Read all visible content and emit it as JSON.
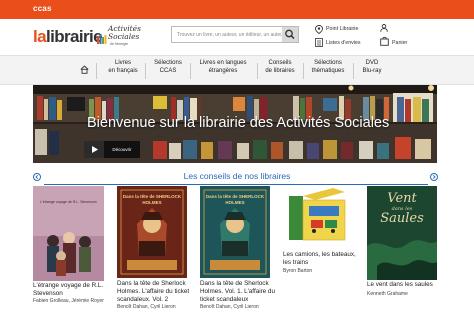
{
  "brand": {
    "ccas": "ccas",
    "la": "la",
    "librairie": "librairie",
    "activites": "Activités Sociales",
    "activites_sub": "de l'énergie"
  },
  "search": {
    "placeholder": "Trouvez un livre, un auteur, un éditeur, un auteur..."
  },
  "header_links": {
    "point_librairie": "Point Librairie",
    "listes_envies": "Listes d'envies",
    "panier": "Panier"
  },
  "nav": [
    {
      "line1": "Livres",
      "line2": "en français"
    },
    {
      "line1": "Sélections",
      "line2": "CCAS"
    },
    {
      "line1": "Livres en langues",
      "line2": "étrangères"
    },
    {
      "line1": "Conseils",
      "line2": "de libraires"
    },
    {
      "line1": "Sélections",
      "line2": "thématiques"
    },
    {
      "line1": "DVD",
      "line2": "Blu-ray"
    }
  ],
  "banner": {
    "title": "Bienvenue sur la librairie des Activités Sociales",
    "button": "Découvrir"
  },
  "section": {
    "title": "Les conseils de nos libraires"
  },
  "books": [
    {
      "title": "L'étrange voyage de R.L. Stevenson",
      "author": "Fabien Grolleau, Jérémie Royer",
      "cover_color": "#c9a2b4"
    },
    {
      "title": "Dans la tête de Sherlock Holmes. L'affaire du ticket scandaleux. Vol. 2",
      "author": "Benoît Dahan, Cyril Lieron",
      "cover_color": "#7a2a1c"
    },
    {
      "title": "Dans la tête de Sherlock Holmes. Vol. 1. L'affaire du ticket scandaleux",
      "author": "Benoît Dahan, Cyril Lieron",
      "cover_color": "#1f5f62"
    },
    {
      "title": "Les camions, les bateaux, les trains",
      "author": "Byron Barton",
      "cover_color": "#e8d34a"
    },
    {
      "title": "Le vent dans les saules",
      "author": "Kenneth Grahame",
      "cover_color": "#1f4a30"
    }
  ],
  "cover_text": {
    "b1_head": "L'étrange voyage de R.L. Stevenson",
    "sherlock": "Dans la tête de SHERLOCK HOLMES",
    "b5_vent": "Vent",
    "b5_dans": "dans les",
    "b5_saules": "Saules"
  },
  "colors": {
    "topbar": "#e94e1b",
    "accent": "#2a6bb5"
  }
}
